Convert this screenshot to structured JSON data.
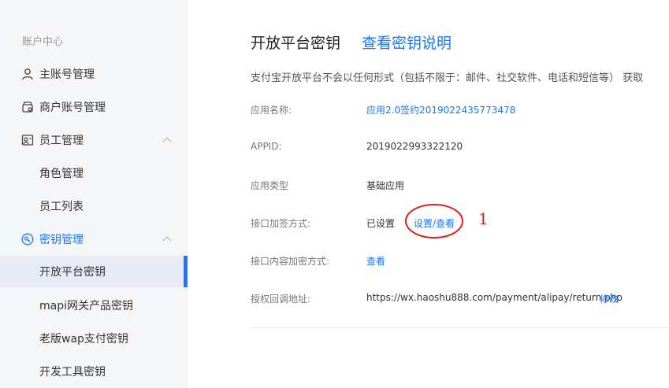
{
  "sidebar": {
    "title": "账户中心",
    "items": [
      {
        "label": "主账号管理",
        "icon": "user-icon"
      },
      {
        "label": "商户账号管理",
        "icon": "store-icon"
      },
      {
        "label": "员工管理",
        "icon": "staff-icon",
        "expanded": true
      },
      {
        "label": "角色管理"
      },
      {
        "label": "员工列表"
      },
      {
        "label": "密钥管理",
        "icon": "key-icon",
        "expanded": true
      },
      {
        "label": "开放平台密钥",
        "active": true
      },
      {
        "label": "mapi网关产品密钥"
      },
      {
        "label": "老版wap支付密钥"
      },
      {
        "label": "开发工具密钥"
      }
    ]
  },
  "main": {
    "title": "开放平台密钥",
    "help_link": "查看密钥说明",
    "notice": "支付宝开放平台不会以任何形式（包括不限于：邮件、社交软件、电话和短信等） 获取",
    "rows": [
      {
        "label": "应用名称:",
        "value": "应用2.0签约2019022435773478"
      },
      {
        "label": "APPID:",
        "value": "2019022993322120"
      },
      {
        "label": "应用类型",
        "value": "基础应用"
      },
      {
        "label": "接口加签方式:",
        "value": "已设置",
        "action": "设置/查看"
      },
      {
        "label": "接口内容加密方式:",
        "value": "查看"
      },
      {
        "label": "授权回调地址:",
        "value": "https://wx.haoshu888.com/payment/alipay/return.php",
        "action": "修改"
      }
    ]
  },
  "annotation": {
    "number": "1",
    "color": "#e0211b"
  },
  "colors": {
    "accent": "#1677ff",
    "sidebar_bg": "#f5f6f8",
    "active_bg": "#e6ebf5"
  }
}
